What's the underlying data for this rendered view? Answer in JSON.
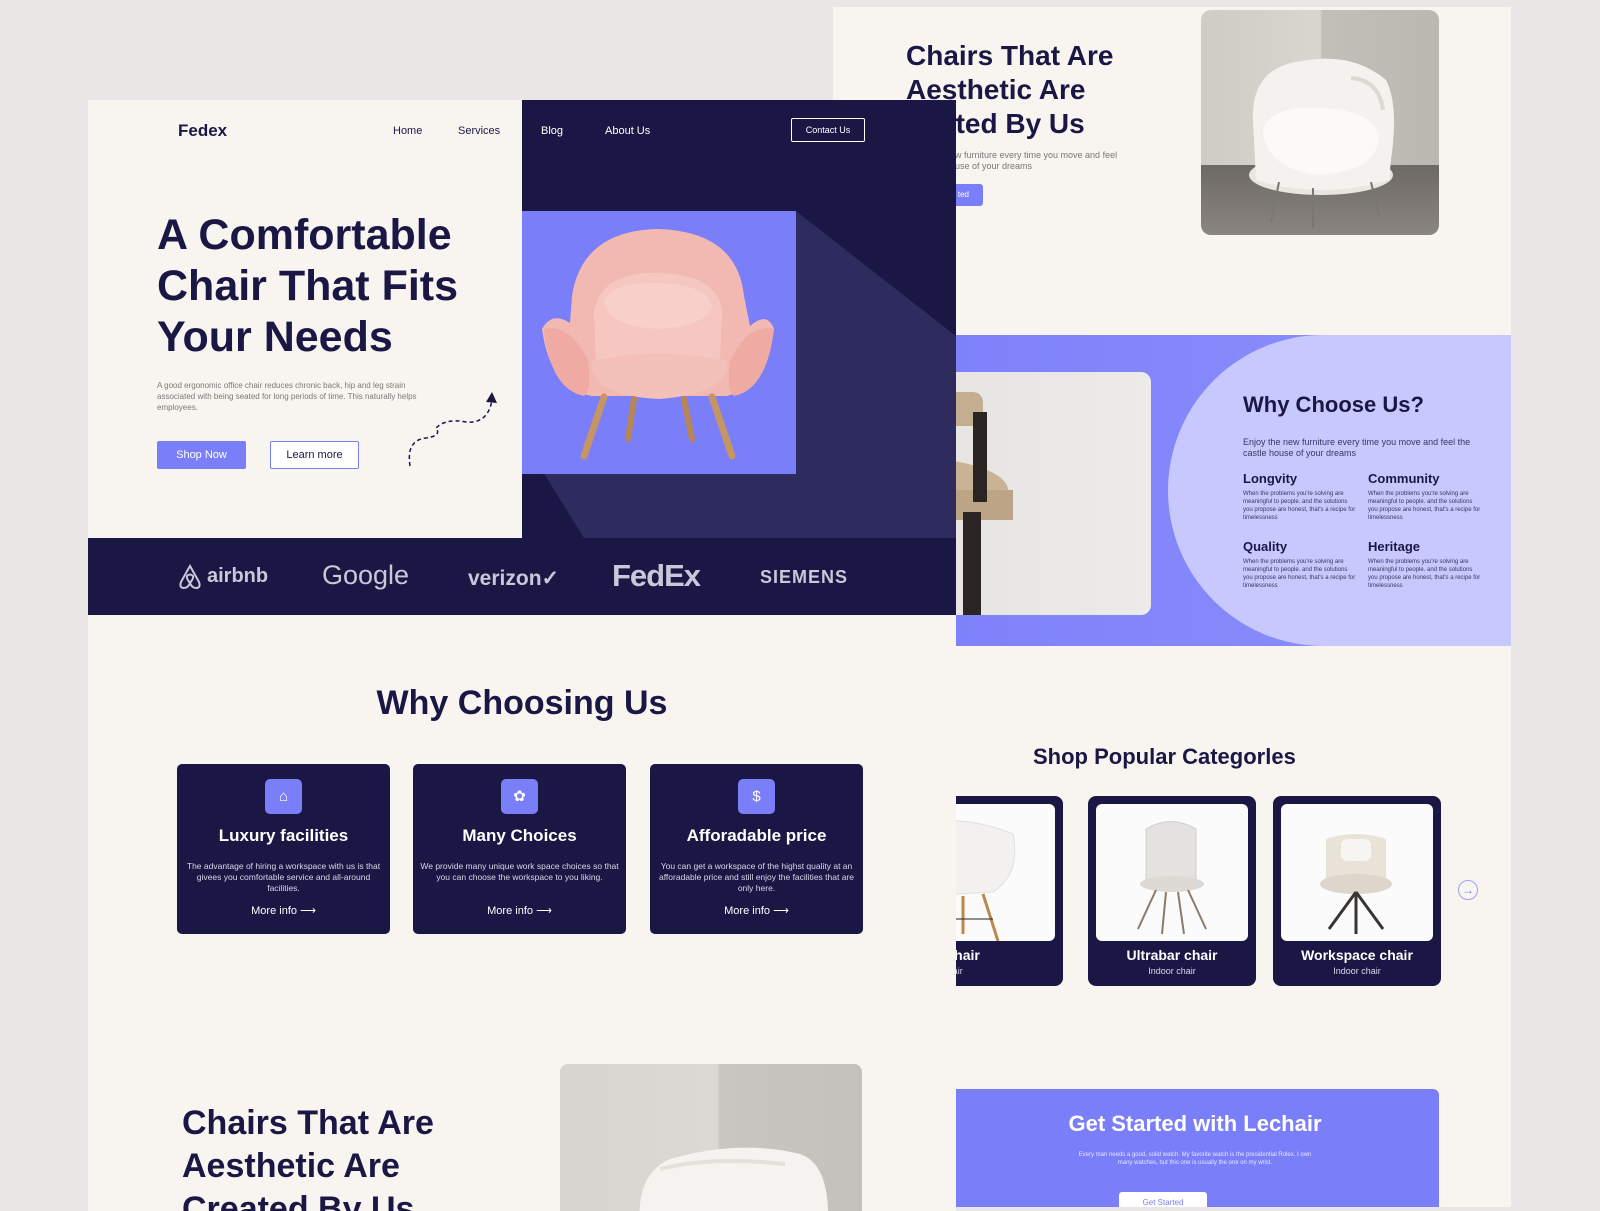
{
  "colors": {
    "navy": "#1a1745",
    "accent": "#7b7ef9",
    "lavender": "#c7c8fd",
    "cream": "#f8f5f0"
  },
  "front": {
    "logo": "Fedex",
    "nav": [
      "Home",
      "Services",
      "Blog",
      "About Us"
    ],
    "contact_label": "Contact Us",
    "hero": {
      "title": "A Comfortable Chair That Fits Your Needs",
      "description": "A good ergonomic office chair reduces chronic back, hip and leg strain associated with being seated for long periods of time. This naturally helps employees.",
      "primary_label": "Shop Now",
      "secondary_label": "Learn more"
    },
    "brands": [
      "airbnb",
      "Google",
      "verizon✓",
      "FedEx",
      "SIEMENS"
    ],
    "why": {
      "title": "Why Choosing Us",
      "cards": [
        {
          "icon": "home-icon",
          "title": "Luxury facilities",
          "desc": "The advantage of hiring a workspace with us is that givees you comfortable service and all-around facilities.",
          "link": "More info"
        },
        {
          "icon": "flower-icon",
          "title": "Many Choices",
          "desc": "We provide many unique work space choices so that you can choose the workspace to you liking.",
          "link": "More info"
        },
        {
          "icon": "price-icon",
          "title": "Afforadable price",
          "desc": "You can get a workspace of the highst quality at an afforadable price and still enjoy the facilities that are only here.",
          "link": "More info"
        }
      ]
    },
    "aesthetic_title": "Chairs That Are Aesthetic Are Created By Us"
  },
  "back": {
    "hero": {
      "title_lines": [
        "Chairs That Are",
        "Aesthetic Are",
        "ated By Us"
      ],
      "desc": "w furniture every time you move and feel use of your dreams",
      "button": "ted"
    },
    "why": {
      "title": "Why Choose Us?",
      "desc": "Enjoy the new furniture every time you move and feel the castle house of your dreams",
      "items": [
        {
          "title": "Longvity",
          "desc": "When the problems you're solving are meaningful to people. and the solutions you propose are honest, that's a recipe for timelessness"
        },
        {
          "title": "Community",
          "desc": "When the problems you're solving are meaningful to people. and the solutions you propose are honest, that's a recipe for timelessness"
        },
        {
          "title": "Quality",
          "desc": "When the problems you're solving are meaningful to people. and the solutions you propose are honest, that's a recipe for timelessness"
        },
        {
          "title": "Heritage",
          "desc": "When the problems you're solving are meaningful to people. and the solutions you propose are honest, that's a recipe for timelessness"
        }
      ]
    },
    "categories": {
      "title": "Shop Popular Categorles",
      "items": [
        {
          "name": "imalist chair",
          "sub": "Indoor chair"
        },
        {
          "name": "Ultrabar chair",
          "sub": "Indoor chair"
        },
        {
          "name": "Workspace chair",
          "sub": "Indoor chair"
        }
      ],
      "next_icon": "arrow-right-circle-icon"
    },
    "cta": {
      "title": "Get Started with Lechair",
      "desc": "Every man needs a good, solid watch. My favorite watch is the presidential Rolex. I own many watches, but this one is usually the one on my wrist.",
      "button": "Get Started"
    }
  }
}
